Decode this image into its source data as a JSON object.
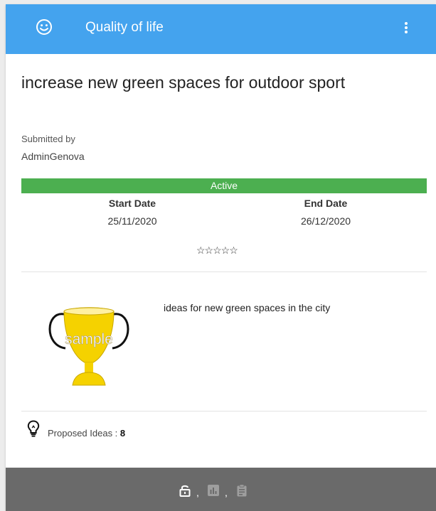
{
  "header": {
    "title": "Quality of life",
    "left_icon": "smiley-icon",
    "menu_icon": "more-vert-icon"
  },
  "challenge": {
    "title": "increase new green spaces for outdoor sport",
    "submitted_by_label": "Submitted by",
    "submitted_by": "AdminGenova",
    "status": "Active",
    "status_color": "#4caf50",
    "start_date_label": "Start Date",
    "start_date": "25/11/2020",
    "end_date_label": "End Date",
    "end_date": "26/12/2020",
    "rating_stars": "☆☆☆☆☆",
    "image_label": "sample",
    "description": "ideas for new green spaces in the city",
    "ideas_label": "Proposed Ideas :",
    "ideas_count": "8"
  },
  "footer": {
    "separator": ",",
    "icons": [
      "lock-open-icon",
      "bar-chart-icon",
      "clipboard-icon"
    ]
  },
  "colors": {
    "header": "#44a3ee",
    "footer": "#6a6a6a",
    "trophy": "#f5d200"
  }
}
